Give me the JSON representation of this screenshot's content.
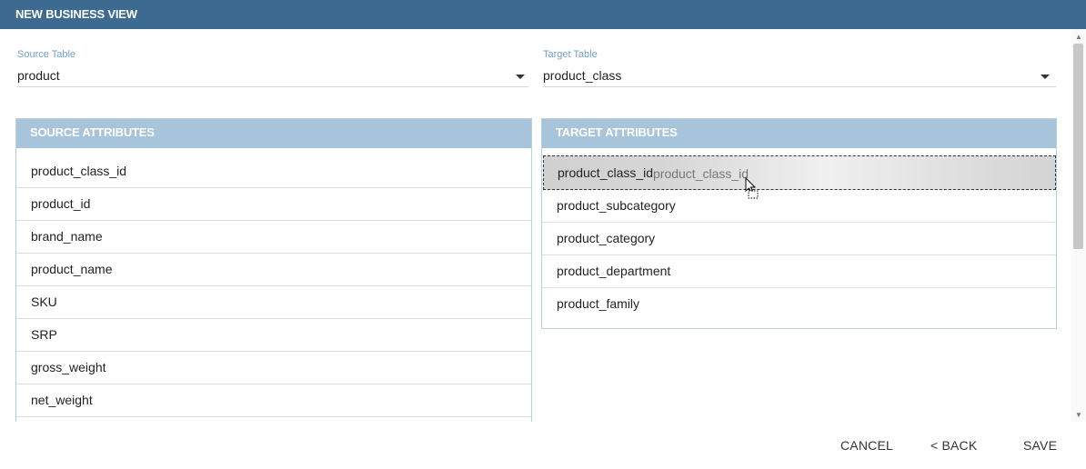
{
  "dialog": {
    "title": "NEW BUSINESS VIEW"
  },
  "source_table": {
    "label": "Source Table",
    "value": "product"
  },
  "target_table": {
    "label": "Target Table",
    "value": "product_class"
  },
  "source_attributes": {
    "header": "SOURCE ATTRIBUTES",
    "items": [
      "product_class_id",
      "product_id",
      "brand_name",
      "product_name",
      "SKU",
      "SRP",
      "gross_weight",
      "net_weight"
    ]
  },
  "target_attributes": {
    "header": "TARGET ATTRIBUTES",
    "items": [
      "product_class_id",
      "product_subcategory",
      "product_category",
      "product_department",
      "product_family"
    ],
    "drag_ghost_text": "product_class_id"
  },
  "footer": {
    "cancel_label": "CANCEL",
    "back_label": "< BACK",
    "save_label": "SAVE"
  },
  "colors": {
    "title_bar": "#3d6a91",
    "panel_header": "#a8c4da",
    "field_label": "#6ea0c9"
  }
}
